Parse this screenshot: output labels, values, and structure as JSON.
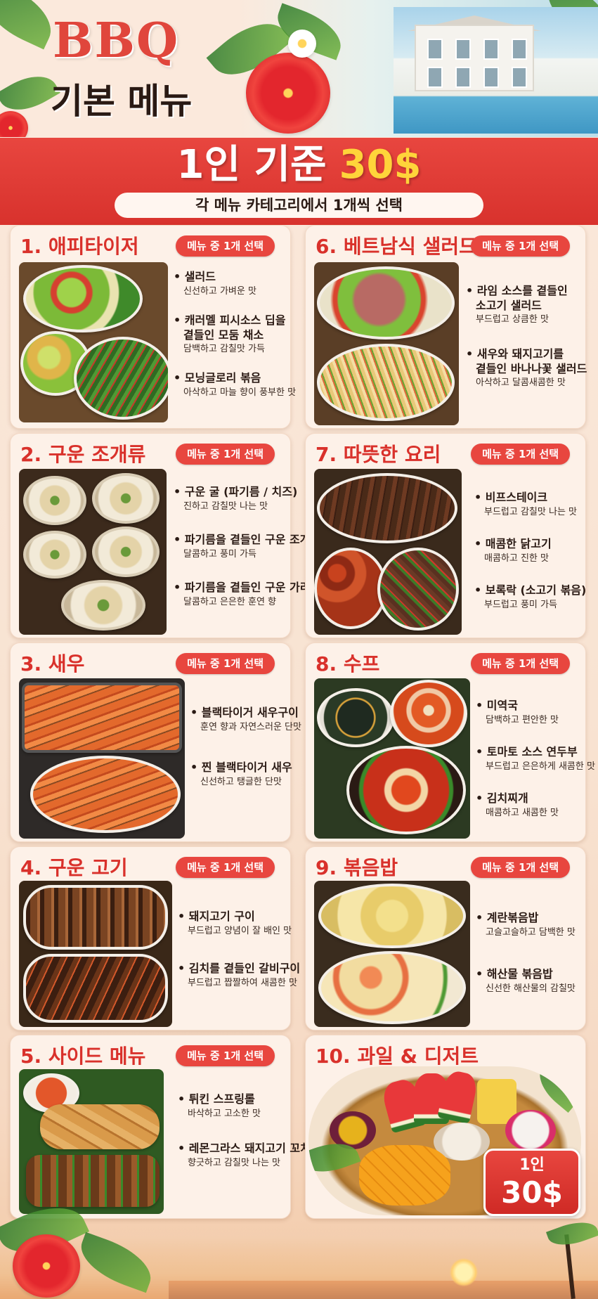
{
  "header": {
    "title": "BBQ",
    "subtitle": "기본 메뉴"
  },
  "banner": {
    "price_label": "1인 기준",
    "price_amount": "30$",
    "subtext": "각 메뉴 카테고리에서 1개씩 선택"
  },
  "choose_label": "메뉴 중 1개 선택",
  "categories": [
    {
      "title": "1. 애피타이저",
      "items": [
        {
          "name": "샐러드",
          "desc": "신선하고 가벼운 맛"
        },
        {
          "name": "캐러멜 피시소스 딥을",
          "name2": "곁들인 모둠 채소",
          "desc": "담백하고 감칠맛 가득"
        },
        {
          "name": "모닝글로리 볶음",
          "desc": "아삭하고 마늘 향이 풍부한 맛"
        }
      ]
    },
    {
      "title": "2. 구운 조개류",
      "items": [
        {
          "name": "구운 굴 (파기름 / 치즈)",
          "desc": "진하고 감칠맛 나는 맛"
        },
        {
          "name": "파기름을 곁들인 구운 조개",
          "desc": "달콤하고 풍미 가득"
        },
        {
          "name": "파기름을 곁들인 구운 가리비",
          "desc": "달콤하고 은은한 훈연 향"
        }
      ]
    },
    {
      "title": "3. 새우",
      "items": [
        {
          "name": "블랙타이거 새우구이",
          "desc": "훈연 향과 자연스러운 단맛"
        },
        {
          "name": "찐 블랙타이거 새우",
          "desc": "신선하고 탱글한 단맛"
        }
      ]
    },
    {
      "title": "4. 구운 고기",
      "items": [
        {
          "name": "돼지고기 구이",
          "desc": "부드럽고 양념이 잘 배인 맛"
        },
        {
          "name": "김치를 곁들인 갈비구이",
          "desc": "부드럽고 짭짤하여 새콤한 맛"
        }
      ]
    },
    {
      "title": "5. 사이드 메뉴",
      "items": [
        {
          "name": "튀킨 스프링롤",
          "desc": "바삭하고 고소한 맛"
        },
        {
          "name": "레몬그라스 돼지고기 꼬치",
          "desc": "향긋하고 감칠맛 나는 맛"
        }
      ]
    },
    {
      "title": "6. 베트남식 샐러드",
      "items": [
        {
          "name": "라임 소스를 곁들인",
          "name2": "소고기 샐러드",
          "desc": "부드럽고 상큼한 맛"
        },
        {
          "name": "새우와 돼지고기를",
          "name2": "곁들인 바나나꽃 샐러드",
          "desc": "아삭하고 달콤새콤한 맛"
        }
      ]
    },
    {
      "title": "7. 따뜻한 요리",
      "items": [
        {
          "name": "비프스테이크",
          "desc": "부드럽고 감칠맛 나는 맛"
        },
        {
          "name": "매콤한 닭고기",
          "desc": "매콤하고 진한 맛"
        },
        {
          "name": "보록락 (소고기 볶음)",
          "desc": "부드럽고 풍미 가득"
        }
      ]
    },
    {
      "title": "8. 수프",
      "items": [
        {
          "name": "미역국",
          "desc": "담백하고 편안한 맛"
        },
        {
          "name": "토마토 소스 연두부",
          "desc": "부드럽고 은은하게 새콤한 맛"
        },
        {
          "name": "김치찌개",
          "desc": "매콤하고 새콤한 맛"
        }
      ]
    },
    {
      "title": "9. 볶음밥",
      "items": [
        {
          "name": "계란볶음밥",
          "desc": "고슬고슬하고 담백한 맛"
        },
        {
          "name": "해산물 볶음밥",
          "desc": "신선한 해산물의 감칠맛"
        }
      ]
    },
    {
      "title": "10. 과일 & 디저트"
    }
  ],
  "badge": {
    "line1": "1인",
    "line2": "30$"
  },
  "colors": {
    "accent_red": "#e8463f",
    "price_yellow": "#ffd43a",
    "card_bg": "#fdf1e8"
  }
}
